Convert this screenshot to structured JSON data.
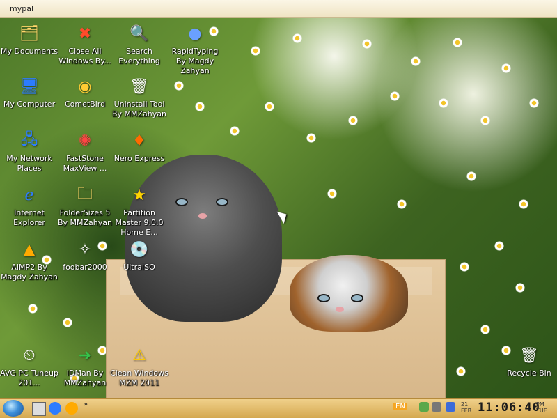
{
  "window": {
    "title": "mypal"
  },
  "desktop": {
    "icons": [
      {
        "id": "my-documents",
        "label": "My Documents",
        "icon": "folder-documents-icon"
      },
      {
        "id": "close-all-windows",
        "label": "Close All Windows By...",
        "icon": "close-x-icon"
      },
      {
        "id": "search-everything",
        "label": "Search Everything",
        "icon": "search-document-icon"
      },
      {
        "id": "rapidtyping",
        "label": "RapidTyping By Magdy Zahyan",
        "icon": "rapidtyping-app-icon"
      },
      {
        "id": "my-computer",
        "label": "My Computer",
        "icon": "computer-icon"
      },
      {
        "id": "cometbird",
        "label": "CometBird",
        "icon": "cometbird-icon"
      },
      {
        "id": "uninstall-tool",
        "label": "Uninstall Tool By MMZahyan",
        "icon": "trash-bin-icon"
      },
      {
        "id": "my-network-places",
        "label": "My Network Places",
        "icon": "network-icon"
      },
      {
        "id": "faststone",
        "label": "FastStone MaxView ...",
        "icon": "faststone-icon"
      },
      {
        "id": "nero-express",
        "label": "Nero Express",
        "icon": "nero-icon"
      },
      {
        "id": "internet-explorer",
        "label": "Internet Explorer",
        "icon": "internet-explorer-icon"
      },
      {
        "id": "foldersizes",
        "label": "FolderSizes 5 By MMZahyan",
        "icon": "folder-sizes-icon"
      },
      {
        "id": "partition-master",
        "label": "Partition Master 9.0.0 Home E...",
        "icon": "partition-master-icon"
      },
      {
        "id": "aimp2",
        "label": "AIMP2 By Magdy Zahyan",
        "icon": "aimp-icon"
      },
      {
        "id": "foobar2000",
        "label": "foobar2000",
        "icon": "foobar-icon"
      },
      {
        "id": "ultraiso",
        "label": "UltraISO",
        "icon": "disc-icon"
      },
      {
        "id": "avg-pc-tuneup",
        "label": "AVG PC Tuneup 201...",
        "icon": "tuneup-icon"
      },
      {
        "id": "idman",
        "label": "IDMan By MMZahyan",
        "icon": "idm-icon"
      },
      {
        "id": "clean-windows",
        "label": "Clean Windows MZM 2011",
        "icon": "warning-triangle-icon"
      },
      {
        "id": "recycle-bin",
        "label": "Recycle Bin",
        "icon": "recycle-bin-icon"
      }
    ]
  },
  "taskbar": {
    "quicklaunch": [
      "show-desktop-icon",
      "internet-explorer-icon",
      "aimp-icon"
    ],
    "more": "»",
    "language": "EN",
    "clock": {
      "time": "11:06:40",
      "day": "21",
      "month": "FEB",
      "ampm": "PM",
      "weekday": "TUE"
    }
  },
  "colors": {
    "taskbar_top": "#f0d08a",
    "taskbar_bottom": "#d4a84f",
    "titlebar": "#fbf6e6"
  }
}
